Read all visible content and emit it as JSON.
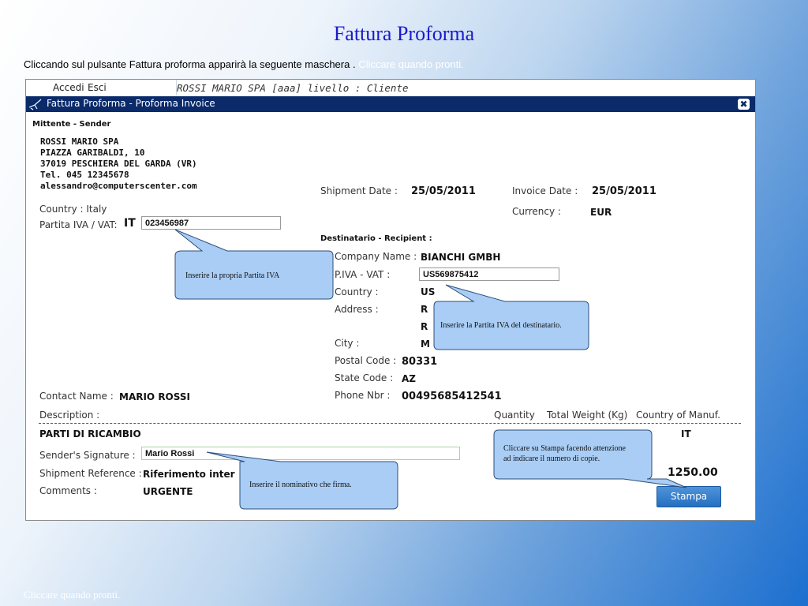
{
  "slide": {
    "title": "Fattura Proforma",
    "intro": "Cliccando sul pulsante Fattura proforma apparirà la seguente maschera .",
    "intro_hint": "Cliccare quando pronti.",
    "footer": "Cliccare quando pronti."
  },
  "menu": {
    "items": [
      "Accedi",
      "Esci"
    ],
    "login_info": "ROSSI MARIO SPA [aaa] livello : Cliente"
  },
  "window": {
    "title": "Fattura Proforma - Proforma Invoice",
    "close_icon": "close-icon"
  },
  "sender": {
    "section_label": "Mittente - Sender",
    "company": "ROSSI MARIO SPA",
    "address": "PIAZZA GARIBALDI, 10",
    "city": "37019 PESCHIERA DEL GARDA (VR)",
    "tel": "Tel. 045 12345678",
    "email": "alessandro@computerscenter.com",
    "country": "Country : Italy",
    "vat_label": "Partita IVA / VAT:",
    "vat_prefix": "IT",
    "vat_value": "023456987"
  },
  "shipment": {
    "date_label": "Shipment Date :",
    "date_value": "25/05/2011",
    "invoice_label": "Invoice Date :",
    "invoice_value": "25/05/2011",
    "currency_label": "Currency :",
    "currency_value": "EUR"
  },
  "recipient": {
    "section_label": "Destinatario - Recipient :",
    "company_label": "Company Name :",
    "company_value": "BIANCHI GMBH",
    "vat_label": "P.IVA - VAT :",
    "vat_value": "US569875412",
    "country_label": "Country :",
    "country_value": "US",
    "address_label": "Address :",
    "address_line1": "R",
    "address_line2": "R",
    "city_label": "City :",
    "city_value": "M",
    "postal_label": "Postal Code :",
    "postal_value": "80331",
    "state_label": "State Code :",
    "state_value": "AZ",
    "phone_label": "Phone Nbr :",
    "phone_value": "00495685412541"
  },
  "contact": {
    "label": "Contact Name :",
    "value": "MARIO ROSSI"
  },
  "items_header": {
    "description": "Description :",
    "quantity": "Quantity",
    "weight": "Total Weight (Kg)",
    "country": "Country of Manuf."
  },
  "item": {
    "description": "PARTI DI RICAMBIO",
    "country": "IT",
    "total": "1250.00"
  },
  "footer_fields": {
    "signature_label": "Sender's Signature :",
    "signature_value": "Mario Rossi",
    "reference_label": "Shipment Reference :",
    "reference_value": "Riferimento inter",
    "comments_label": "Comments :",
    "comments_value": "URGENTE"
  },
  "stamp_button": "Stampa",
  "callouts": {
    "sender_vat": "Inserire la propria Partita IVA",
    "recipient_vat": "Inserire la Partita IVA del destinatario.",
    "signature": "Inserire il nominativo che firma.",
    "print_line1": "Cliccare su Stampa facendo attenzione",
    "print_line2": "ad indicare il numero di copie."
  },
  "colors": {
    "title_blue": "#1a1acc",
    "titlebar_navy": "#0a2a6a",
    "callout_fill": "#a9cdf5",
    "button_blue": "#2f7fd0"
  }
}
